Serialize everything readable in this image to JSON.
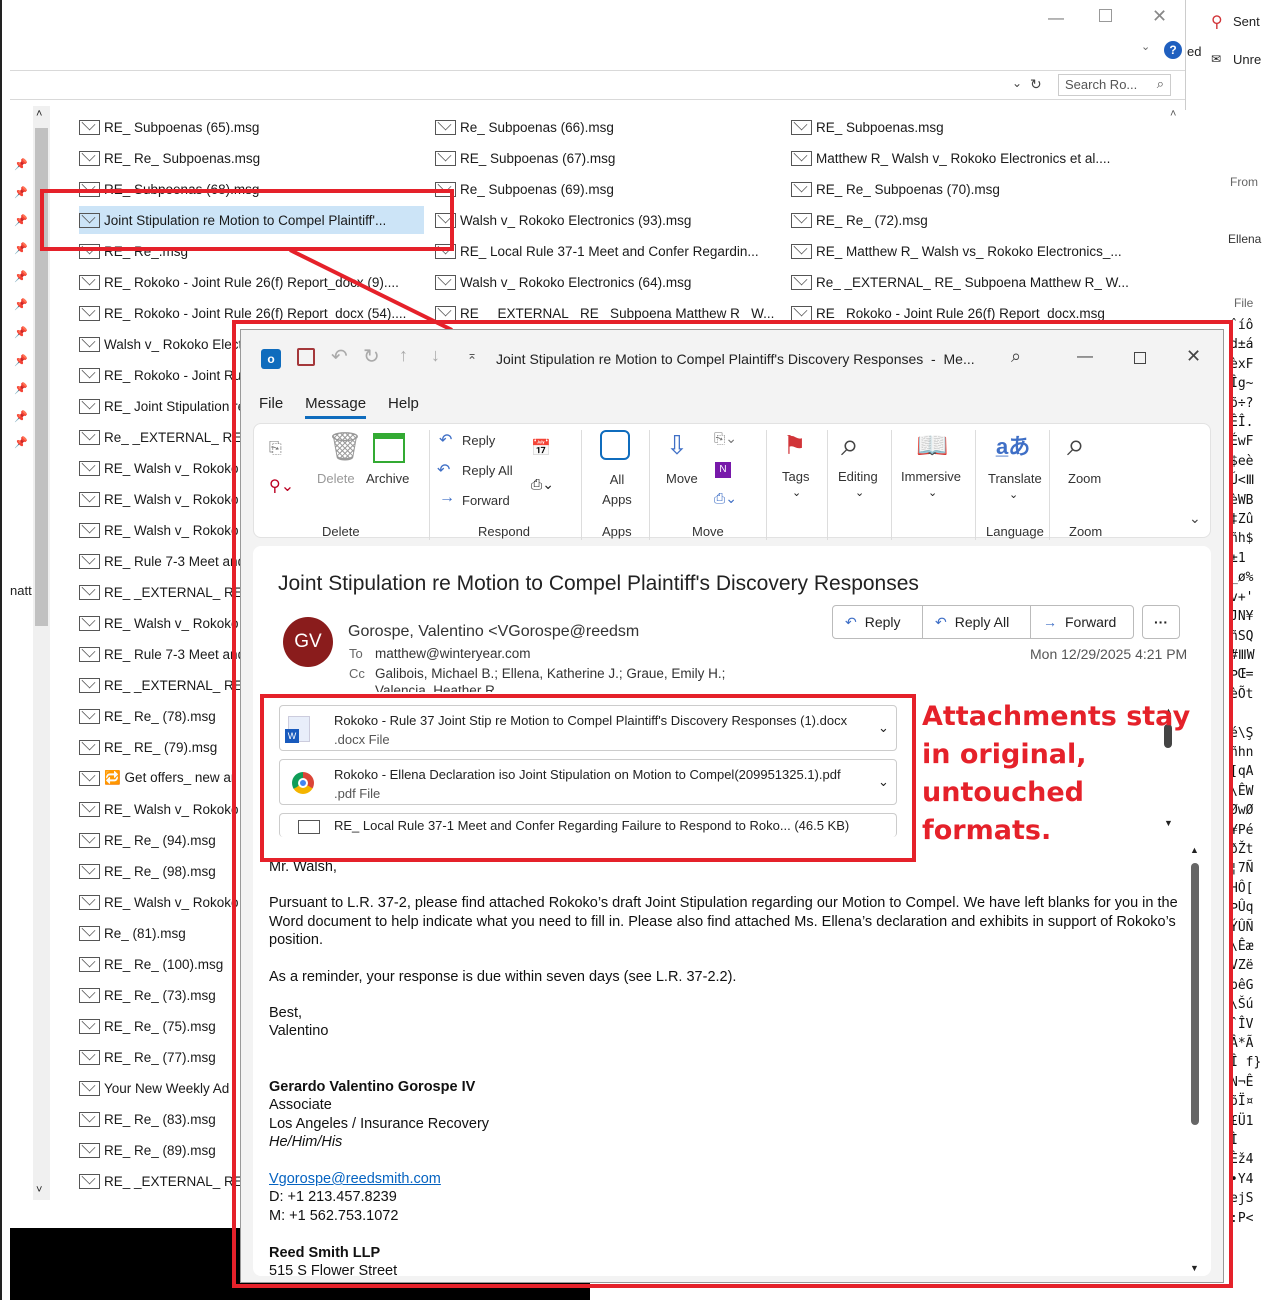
{
  "explorer": {
    "search_placeholder": "Search Ro...",
    "side_text": "natt",
    "right_pane": {
      "sent": "Sent",
      "ed": "ed",
      "unread": "Unre",
      "from": "From",
      "ellena": "Ellena",
      "file": "File"
    }
  },
  "files": {
    "col1": [
      "RE_ Subpoenas (65).msg",
      "RE_ Re_ Subpoenas.msg",
      "RE_ Subpoenas (68).msg",
      "Joint Stipulation re Motion to Compel Plaintiff'...",
      "RE_ Re_.msg",
      "RE_ Rokoko - Joint Rule 26(f) Report_docx (9)....",
      "RE_ Rokoko - Joint Rule 26(f) Report_docx (54)....",
      "Walsh v_ Rokoko Electronics",
      "RE_ Rokoko - Joint Rule",
      "RE_ Joint Stipulation re",
      "Re_ _EXTERNAL_ RE_ Subpoena",
      "RE_ Walsh v_ Rokoko E",
      "RE_ Walsh v_ Rokoko E",
      "RE_ Walsh v_ Rokoko E",
      "RE_ Rule 7-3 Meet and",
      "RE_ _EXTERNAL_ RE_ S",
      "RE_ Walsh v_ Rokoko E",
      "RE_ Rule 7-3 Meet and",
      "RE_ _EXTERNAL_ RE_ S",
      "RE_ Re_ (78).msg",
      "RE_ RE_ (79).msg",
      "🔁 Get offers_ new ar",
      "RE_ Walsh v_ Rokoko E",
      "RE_ Re_ (94).msg",
      "RE_ Re_ (98).msg",
      "RE_ Walsh v_ Rokoko E",
      "Re_ (81).msg",
      "RE_ Re_ (100).msg",
      "RE_ Re_ (73).msg",
      "RE_ Re_ (75).msg",
      "RE_ Re_ (77).msg",
      "Your New Weekly Ad",
      "RE_ Re_ (83).msg",
      "RE_ Re_ (89).msg",
      "RE_ _EXTERNAL_ RE_ S"
    ],
    "col2": [
      "Re_ Subpoenas (66).msg",
      "RE_ Subpoenas (67).msg",
      "Re_ Subpoenas (69).msg",
      "Walsh v_ Rokoko Electronics (93).msg",
      "RE_ Local Rule 37-1 Meet and Confer Regardin...",
      "Walsh v_ Rokoko Electronics (64).msg",
      "RE_ _EXTERNAL_ RE_ Subpoena Matthew R_ W..."
    ],
    "col3": [
      "RE_ Subpoenas.msg",
      "Matthew R_ Walsh v_ Rokoko Electronics et al....",
      "RE_ Re_ Subpoenas (70).msg",
      "RE_ Re_ (72).msg",
      "RE_ Matthew R_ Walsh vs_ Rokoko Electronics_...",
      "Re_ _EXTERNAL_ RE_ Subpoena Matthew R_ W...",
      "RE_ Rokoko - Joint Rule 26(f) Report_docx.msg"
    ]
  },
  "mail_window": {
    "title": "Joint Stipulation re Motion to Compel Plaintiff's Discovery Responses  -  Me...",
    "tabs": [
      "File",
      "Message",
      "Help"
    ],
    "ribbon": {
      "delete": "Delete",
      "archive": "Archive",
      "group_delete": "Delete",
      "reply": "Reply",
      "reply_all": "Reply All",
      "forward": "Forward",
      "group_respond": "Respond",
      "all_apps": "All Apps",
      "group_apps": "Apps",
      "move": "Move",
      "group_move": "Move",
      "tags": "Tags",
      "editing": "Editing",
      "immersive": "Immersive",
      "translate": "Translate",
      "group_language": "Language",
      "zoom": "Zoom",
      "group_zoom": "Zoom"
    },
    "subject": "Joint Stipulation re Motion to Compel Plaintiff's Discovery Responses",
    "avatar": "GV",
    "sender": "Gorospe, Valentino <VGorospe@reedsm",
    "to_label": "To",
    "to": "matthew@winteryear.com",
    "cc_label": "Cc",
    "cc": "Galibois, Michael B.; Ellena, Katherine J.; Graue, Emily H.;",
    "cc2": "Valencia, Heather R.",
    "date": "Mon 12/29/2025 4:21 PM",
    "buttons": {
      "reply": "Reply",
      "reply_all": "Reply All",
      "forward": "Forward",
      "more": "···"
    },
    "attachments": [
      {
        "name": "Rokoko - Rule 37 Joint Stip re Motion to Compel Plaintiff's Discovery Responses (1).docx",
        "type": ".docx File"
      },
      {
        "name": "Rokoko - Ellena Declaration iso Joint Stipulation on Motion to Compel(209951325.1).pdf",
        "type": ".pdf File"
      },
      {
        "name": "RE_ Local Rule 37-1 Meet and Confer Regarding Failure to Respond to Roko... (46.5 KB)",
        "type": ""
      }
    ],
    "body": {
      "greeting": "Mr. Walsh,",
      "p1": "Pursuant to L.R. 37-2, please find attached Rokoko’s draft Joint Stipulation regarding our Motion to Compel.  We have left blanks for you in the Word document to help indicate what you need to fill in.  Please also find attached Ms. Ellena’s declaration and exhibits in support of Rokoko’s position.",
      "p2": "As a reminder, your response is due within seven days (see L.R. 37-2.2).",
      "closing": "Best,",
      "closing_name": "Valentino",
      "sig_name": "Gerardo Valentino Gorospe IV",
      "sig_title": "Associate",
      "sig_dept": "Los Angeles / Insurance Recovery",
      "sig_pronouns": "He/Him/His",
      "sig_email": "Vgorospe@reedsmith.com",
      "sig_d": "D: +1 213.457.8239",
      "sig_m": "M: +1 562.753.1072",
      "firm": "Reed Smith LLP",
      "address": "515 S Flower Street"
    }
  },
  "annotation": {
    "line1": "Attachments stay",
    "line2": "in original,",
    "line3": "untouched",
    "line4": "formats."
  },
  "garbled_right": "ˆíô\nd±á\nèxF\nÎg~\nõ÷?\nÊÎ.\nÉwF\n$eè\nÚ<Ⅲ\nèWB\n‡Zû\nñh$\n±1\n_ø%\nv+'\nJN¥\nñSQ\n#ⅢW\nÞŒ=\nèÕt\n\né\\Ş\nñhn\n[qA\n\\ÊW\nØwØ\n¥Pé\nðŽt\n¦7Ñ\nHÔ[\nÞÛq\nÝÛÑ\n\\Êæ\nVZë\nþêG\n\\Šú\nˆÎV\nÂ*Ã\nÎ f}\nN¬Ê\nõÏ¤\n£Ü1\nÌ\nÈž4\n•Y4\nejS\n:P<",
  "colors": {
    "accent": "#0f6cbd",
    "annotation_red": "#e5212a",
    "avatar_bg": "#8a1c1c"
  }
}
